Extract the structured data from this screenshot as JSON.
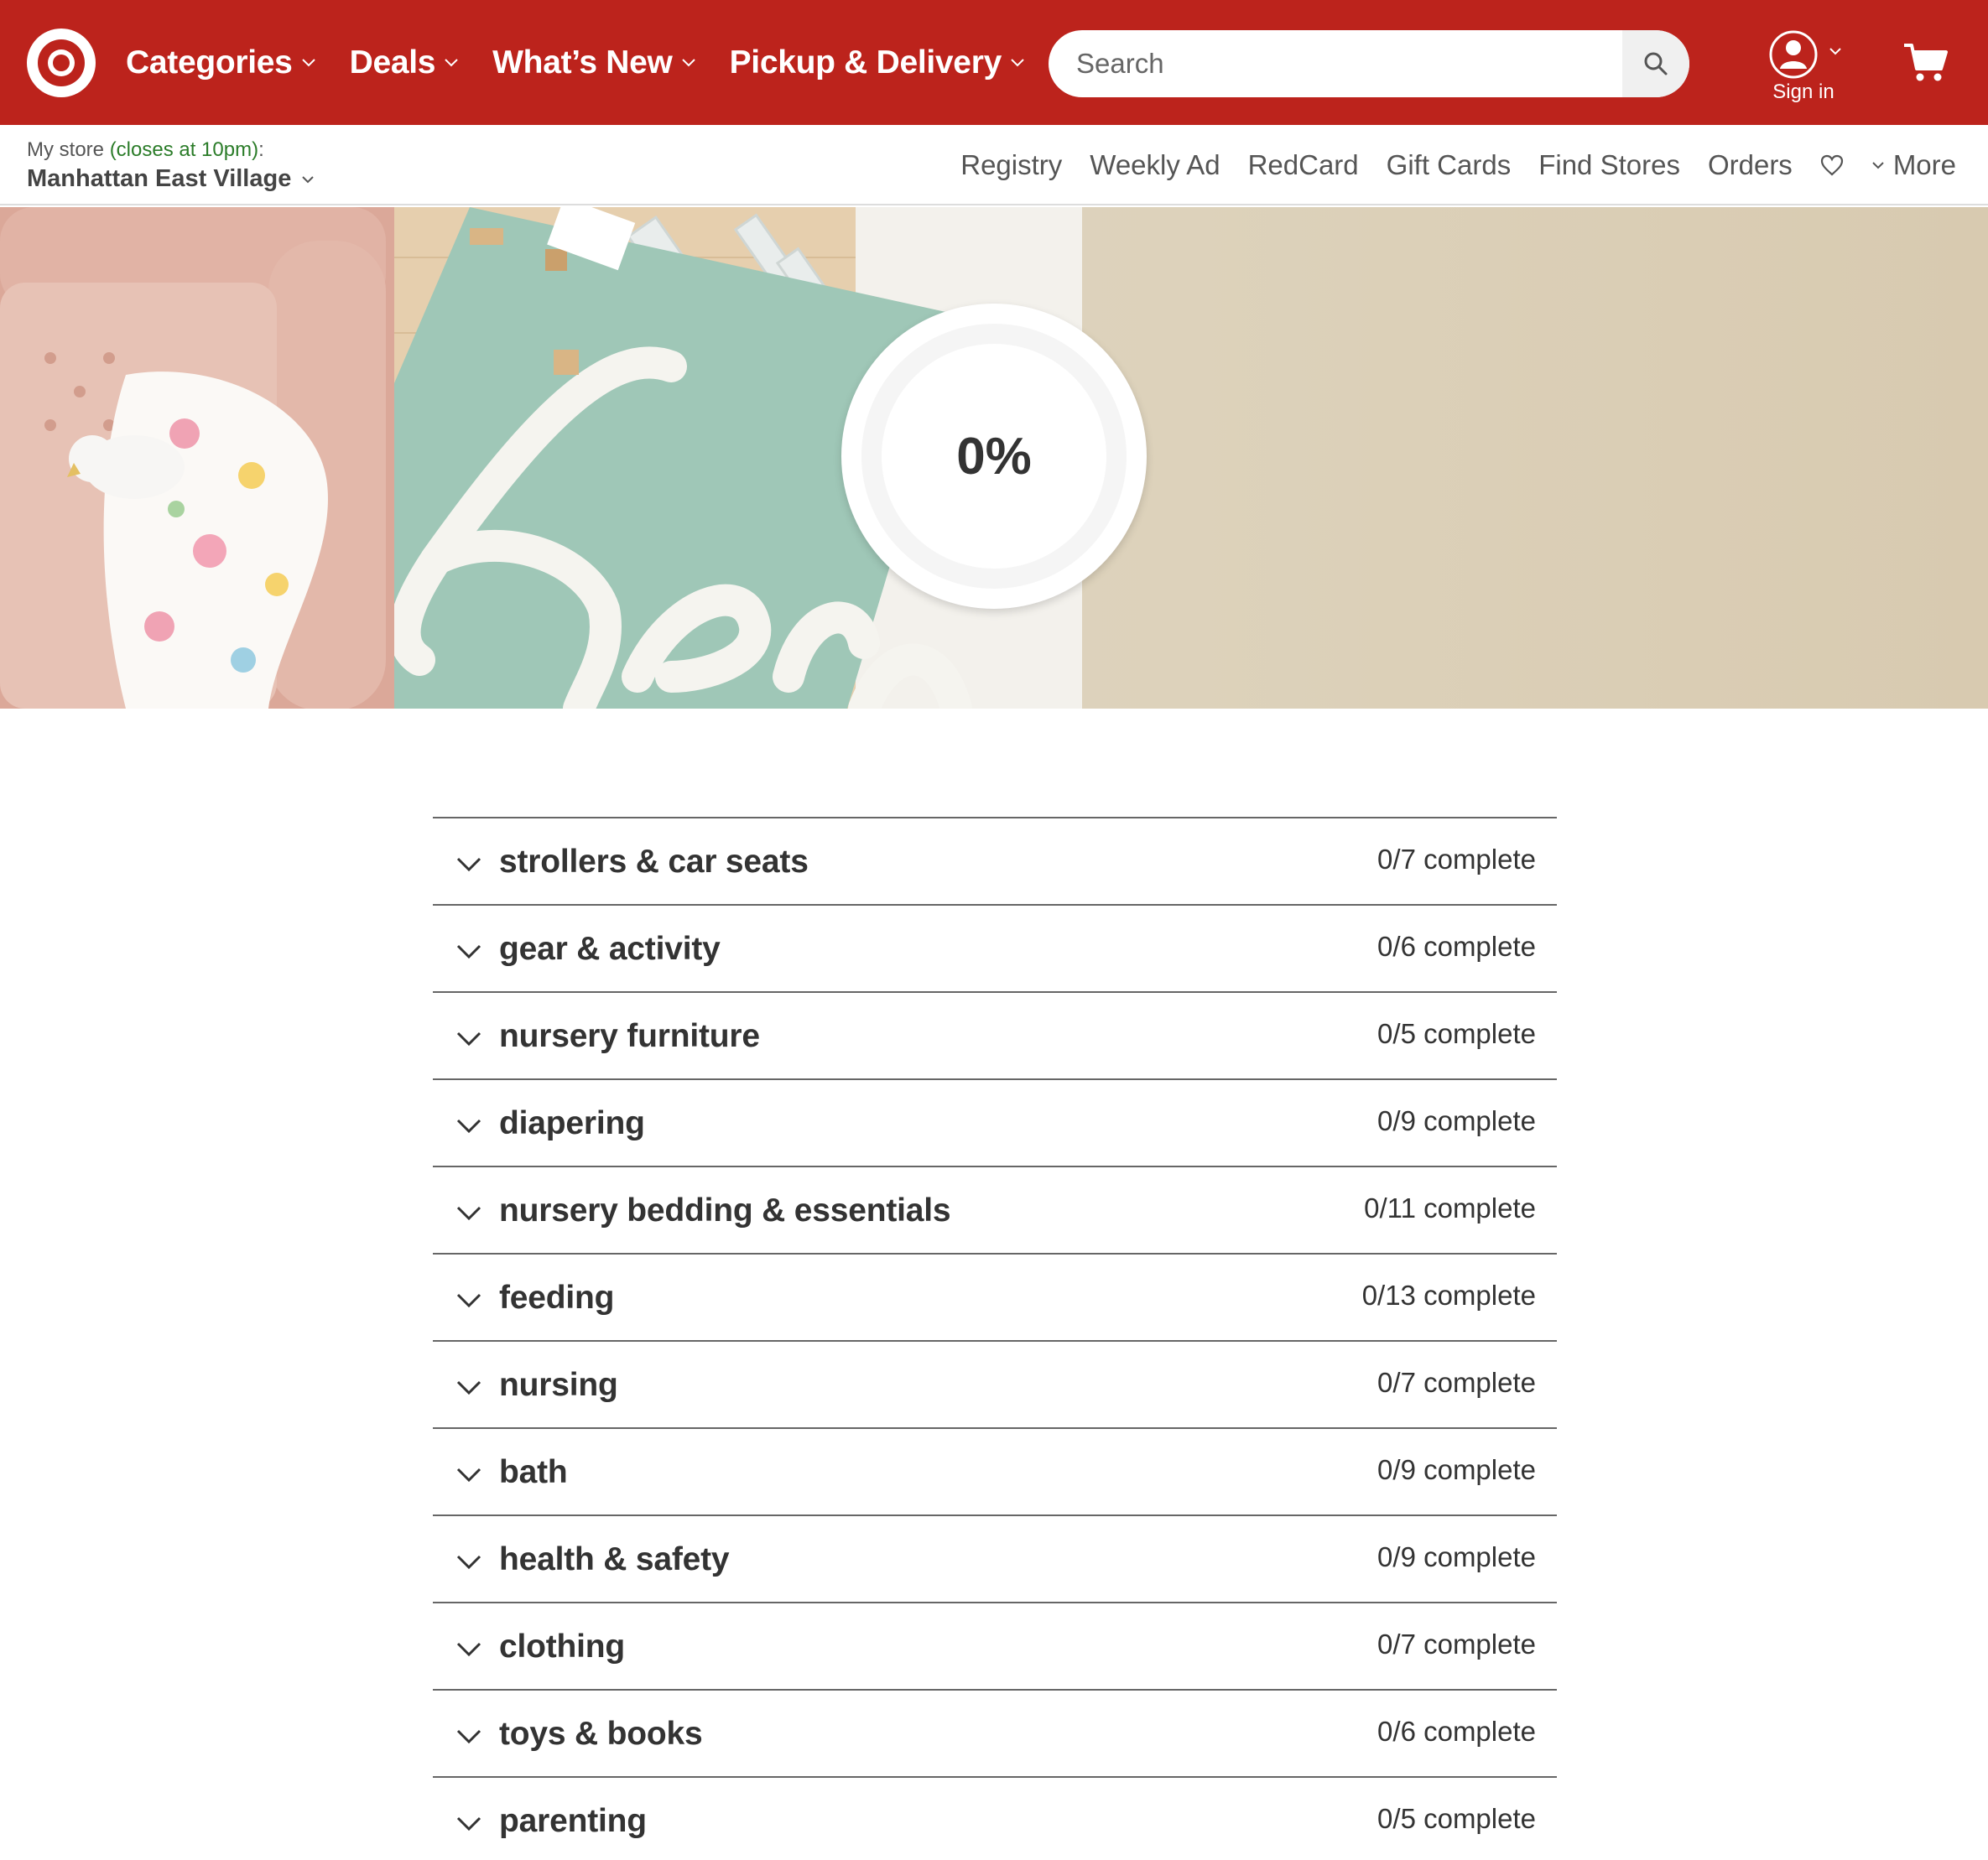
{
  "header": {
    "nav": [
      {
        "label": "Categories"
      },
      {
        "label": "Deals"
      },
      {
        "label": "What’s New"
      },
      {
        "label": "Pickup & Delivery"
      }
    ],
    "search": {
      "placeholder": "Search"
    },
    "account": {
      "label": "Sign in"
    },
    "brand_color": "#bc231c"
  },
  "subheader": {
    "store_prefix": "My store",
    "store_hours": "(closes at 10pm)",
    "store_suffix": ":",
    "store_name": "Manhattan East Village",
    "links": [
      {
        "label": "Registry"
      },
      {
        "label": "Weekly Ad"
      },
      {
        "label": "RedCard"
      },
      {
        "label": "Gift Cards"
      },
      {
        "label": "Find Stores"
      },
      {
        "label": "Orders"
      }
    ],
    "more_label": "More"
  },
  "hero": {
    "progress_label": "0%",
    "progress_value": 0
  },
  "checklist": [
    {
      "name": "strollers & car seats",
      "count": "0/7 complete"
    },
    {
      "name": "gear & activity",
      "count": "0/6 complete"
    },
    {
      "name": "nursery furniture",
      "count": "0/5 complete"
    },
    {
      "name": "diapering",
      "count": "0/9 complete"
    },
    {
      "name": "nursery bedding & essentials",
      "count": "0/11 complete"
    },
    {
      "name": "feeding",
      "count": "0/13 complete"
    },
    {
      "name": "nursing",
      "count": "0/7 complete"
    },
    {
      "name": "bath",
      "count": "0/9 complete"
    },
    {
      "name": "health & safety",
      "count": "0/9 complete"
    },
    {
      "name": "clothing",
      "count": "0/7 complete"
    },
    {
      "name": "toys & books",
      "count": "0/6 complete"
    },
    {
      "name": "parenting",
      "count": "0/5 complete"
    }
  ]
}
